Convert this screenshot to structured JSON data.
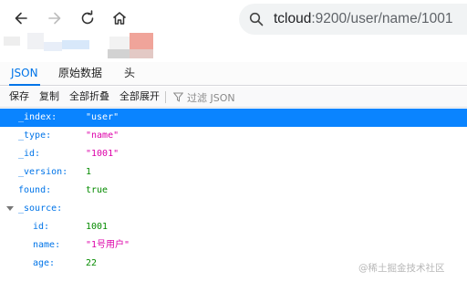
{
  "browser": {
    "url_host": "tcloud",
    "url_path": ":9200/user/name/1001"
  },
  "viewer": {
    "tabs": [
      "JSON",
      "原始数据",
      "头"
    ],
    "actions": {
      "save": "保存",
      "copy": "复制",
      "collapse_all": "全部折叠",
      "expand_all": "全部展开",
      "filter_placeholder": "过滤 JSON"
    }
  },
  "json": {
    "index_key": "_index:",
    "index_val": "\"user\"",
    "type_key": "_type:",
    "type_val": "\"name\"",
    "id_key": "_id:",
    "id_val": "\"1001\"",
    "version_key": "_version:",
    "version_val": "1",
    "found_key": "found:",
    "found_val": "true",
    "source_key": "_source:",
    "src_id_key": "id:",
    "src_id_val": "1001",
    "src_name_key": "name:",
    "src_name_val": "\"1号用户\"",
    "src_age_key": "age:",
    "src_age_val": "22"
  },
  "watermark": "@稀土掘金技术社区",
  "colors": {
    "selected_row": "#0a84ff",
    "key": "#0074e8",
    "string": "#dd00a9",
    "number": "#058b00"
  }
}
